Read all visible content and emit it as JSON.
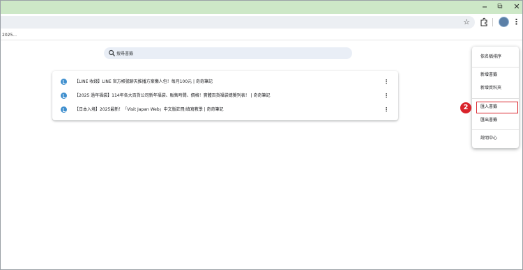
{
  "window": {
    "minimize_icon": "minimize-icon",
    "restore_label": "⧉",
    "close_label": "✕",
    "accent_color": "#cde8c7"
  },
  "toolbar": {
    "star_label": "☆",
    "menu_label": "⋮"
  },
  "bookmarks_bar": {
    "items": [
      {
        "label": "2025..."
      }
    ]
  },
  "search": {
    "value": "搜尋書籤",
    "placeholder": ""
  },
  "results": [
    {
      "title": "【LINE 收錢】LINE 官方帳號聊天推播方案懶人包！每月100元 | 奇奇筆記",
      "menu_label": "⋮"
    },
    {
      "title": "【2025 過年福袋】114年各大百貨公司新年福袋、販售時間、價格！實體百貨福袋總獎列表！ | 奇奇筆記",
      "menu_label": "⋮"
    },
    {
      "title": "【日本入境】2025最新！「Visit Japan Web」中文版註冊/填寫教學 | 奇奇筆記",
      "menu_label": "⋮"
    }
  ],
  "menu": {
    "items": [
      {
        "label": "依名稱排序"
      },
      {
        "label": "新增書籤"
      },
      {
        "label": "新增資料夾"
      },
      {
        "label": "匯入書籤"
      },
      {
        "label": "匯出書籤"
      },
      {
        "label": "說明中心"
      }
    ],
    "highlight_color": "#d9232a"
  },
  "annotation": {
    "step_number": "2"
  }
}
